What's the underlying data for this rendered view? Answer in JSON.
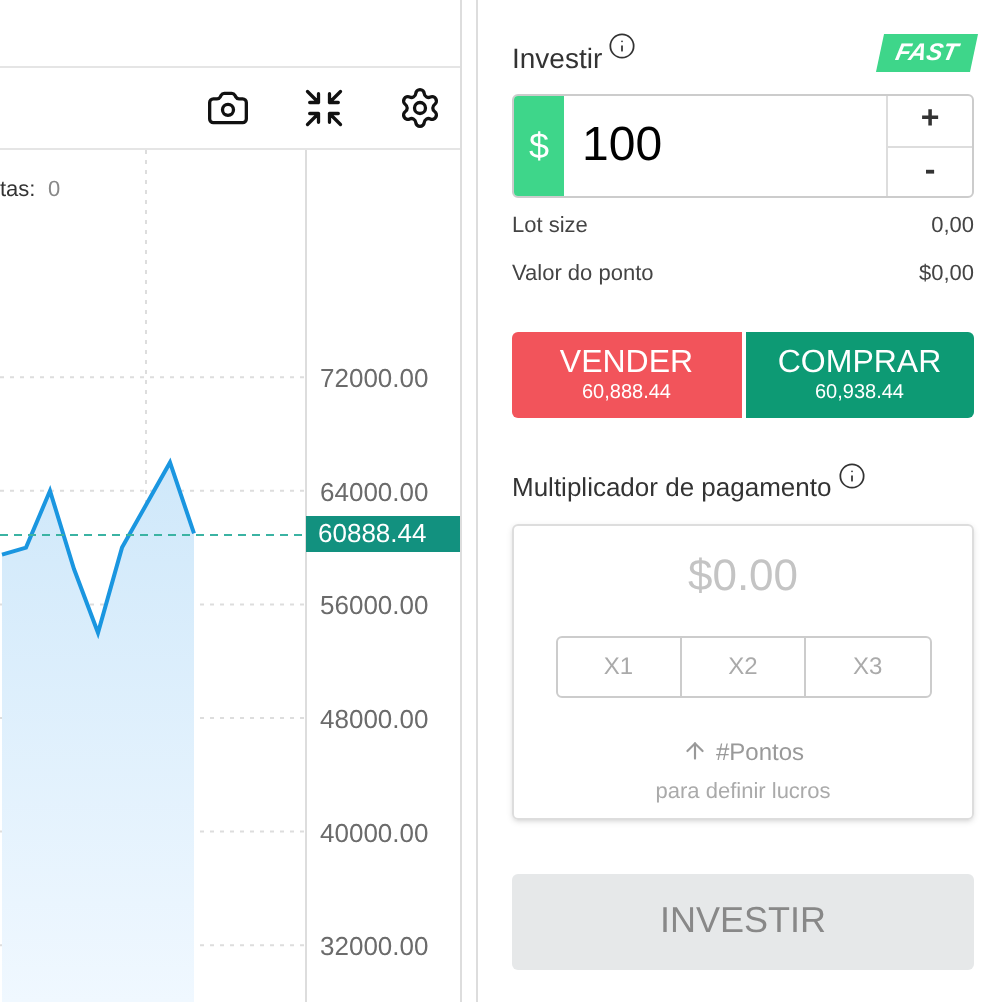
{
  "chart": {
    "legend_label": "tas:",
    "legend_value": "0",
    "price_label": "60888.44",
    "chart_data": {
      "type": "area",
      "grid": true,
      "categories": [
        null,
        null,
        null,
        null,
        null,
        null,
        null,
        null,
        null
      ],
      "ylim": [
        28000,
        88000
      ],
      "yticks": [
        {
          "value": 72000,
          "label": "72000.00"
        },
        {
          "value": 64000,
          "label": "64000.00"
        },
        {
          "value": 56000,
          "label": "56000.00"
        },
        {
          "value": 48000,
          "label": "48000.00"
        },
        {
          "value": 40000,
          "label": "40000.00"
        },
        {
          "value": 32000,
          "label": "32000.00"
        }
      ],
      "series": [
        {
          "color": "#1a96e0",
          "values": [
            59500,
            60000,
            64000,
            58500,
            54000,
            60000,
            63000,
            66000,
            61000
          ]
        }
      ]
    }
  },
  "trade": {
    "investir_label": "Investir",
    "fast_badge": "FAST",
    "currency": "$",
    "amount": "100",
    "plus": "+",
    "minus": "-",
    "info_rows": [
      {
        "label": "Lot size",
        "value": "0,00"
      },
      {
        "label": "Valor do ponto",
        "value": "$0,00"
      }
    ],
    "sell": {
      "label": "VENDER",
      "price": "60,888.44"
    },
    "buy": {
      "label": "COMPRAR",
      "price": "60,938.44"
    },
    "multiplier_label": "Multiplicador de pagamento",
    "payout": "$0.00",
    "multipliers": [
      {
        "label": "X1",
        "selected": false
      },
      {
        "label": "X2",
        "selected": false
      },
      {
        "label": "X3",
        "selected": false
      }
    ],
    "points_label": "#Pontos",
    "points_hint": "para definir lucros",
    "invest_button": {
      "label": "INVESTIR",
      "disabled": true
    }
  }
}
